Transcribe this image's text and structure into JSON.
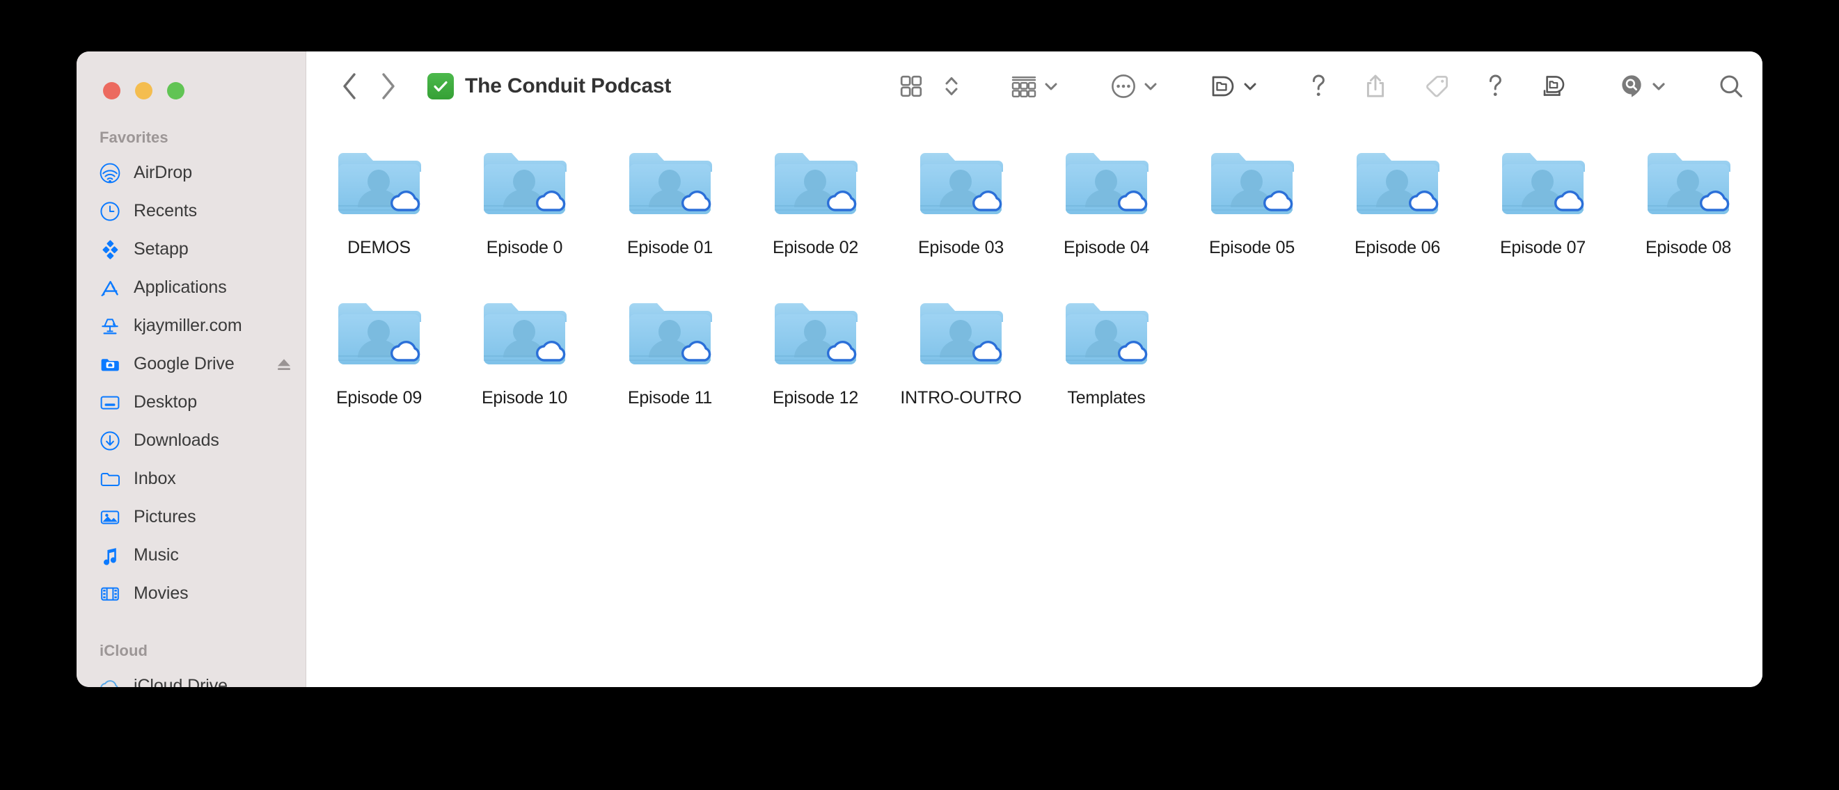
{
  "window": {
    "title": "The Conduit Podcast",
    "title_badge_icon": "green-checkmark-icon",
    "traffic_lights": {
      "close_label": "Close",
      "minimize_label": "Minimize",
      "zoom_label": "Zoom"
    }
  },
  "toolbar": {
    "back_icon": "chevron-left-icon",
    "forward_icon": "chevron-right-icon",
    "view_icon": "icon-view-grid-icon",
    "view_stepper_icon": "up-down-chevron-icon",
    "group_icon": "group-by-icon",
    "group_chevron_icon": "chevron-down-icon",
    "more_icon": "ellipsis-circle-icon",
    "more_chevron_icon": "chevron-down-icon",
    "arrange_icon": "folder-badge-icon",
    "arrange_chevron_icon": "chevron-down-icon",
    "help_icon": "question-mark-icon",
    "share_icon": "share-upload-icon",
    "tag_icon": "tag-icon",
    "help2_icon": "question-mark-icon",
    "stack_icon": "stacked-folders-icon",
    "search_pin_icon": "search-pin-icon",
    "search_pin_chevron_icon": "chevron-down-icon",
    "search_icon": "search-magnifier-icon"
  },
  "sidebar": {
    "sections": [
      {
        "header": "Favorites",
        "items": [
          {
            "label": "AirDrop",
            "icon": "airdrop-icon",
            "eject": false
          },
          {
            "label": "Recents",
            "icon": "clock-icon",
            "eject": false
          },
          {
            "label": "Setapp",
            "icon": "setapp-diamond-icon",
            "eject": false
          },
          {
            "label": "Applications",
            "icon": "applications-icon",
            "eject": false
          },
          {
            "label": "kjaymiller.com",
            "icon": "server-icon",
            "eject": false
          },
          {
            "label": "Google Drive",
            "icon": "google-drive-folder-icon",
            "eject": true
          },
          {
            "label": "Desktop",
            "icon": "desktop-icon",
            "eject": false
          },
          {
            "label": "Downloads",
            "icon": "downloads-icon",
            "eject": false
          },
          {
            "label": "Inbox",
            "icon": "folder-icon",
            "eject": false
          },
          {
            "label": "Pictures",
            "icon": "pictures-icon",
            "eject": false
          },
          {
            "label": "Music",
            "icon": "music-note-icon",
            "eject": false
          },
          {
            "label": "Movies",
            "icon": "film-icon",
            "eject": false
          }
        ]
      },
      {
        "header": "iCloud",
        "items": [
          {
            "label": "iCloud Drive",
            "icon": "icloud-icon",
            "eject": false
          }
        ]
      }
    ]
  },
  "files": [
    {
      "name": "DEMOS",
      "icon": "shared-folder-cloud-icon"
    },
    {
      "name": "Episode 0",
      "icon": "shared-folder-cloud-icon"
    },
    {
      "name": "Episode 01",
      "icon": "shared-folder-cloud-icon"
    },
    {
      "name": "Episode 02",
      "icon": "shared-folder-cloud-icon"
    },
    {
      "name": "Episode 03",
      "icon": "shared-folder-cloud-icon"
    },
    {
      "name": "Episode 04",
      "icon": "shared-folder-cloud-icon"
    },
    {
      "name": "Episode 05",
      "icon": "shared-folder-cloud-icon"
    },
    {
      "name": "Episode 06",
      "icon": "shared-folder-cloud-icon"
    },
    {
      "name": "Episode 07",
      "icon": "shared-folder-cloud-icon"
    },
    {
      "name": "Episode 08",
      "icon": "shared-folder-cloud-icon"
    },
    {
      "name": "Episode 09",
      "icon": "shared-folder-cloud-icon"
    },
    {
      "name": "Episode 10",
      "icon": "shared-folder-cloud-icon"
    },
    {
      "name": "Episode 11",
      "icon": "shared-folder-cloud-icon"
    },
    {
      "name": "Episode 12",
      "icon": "shared-folder-cloud-icon"
    },
    {
      "name": "INTRO-OUTRO",
      "icon": "shared-folder-cloud-icon"
    },
    {
      "name": "Templates",
      "icon": "shared-folder-cloud-icon"
    }
  ],
  "colors": {
    "sidebar_bg": "#e8e3e3",
    "content_bg": "#ffffff",
    "accent_blue": "#0b7aff",
    "folder_blue": "#8ecbf0",
    "traffic_red": "#ec6a5f",
    "traffic_yellow": "#f4bd4f",
    "traffic_green": "#61c454",
    "checkmark_green": "#3ba93b",
    "label_text": "#1c1c1c",
    "section_header_text": "#9c9696",
    "toolbar_icon": "#7a7a7a"
  }
}
